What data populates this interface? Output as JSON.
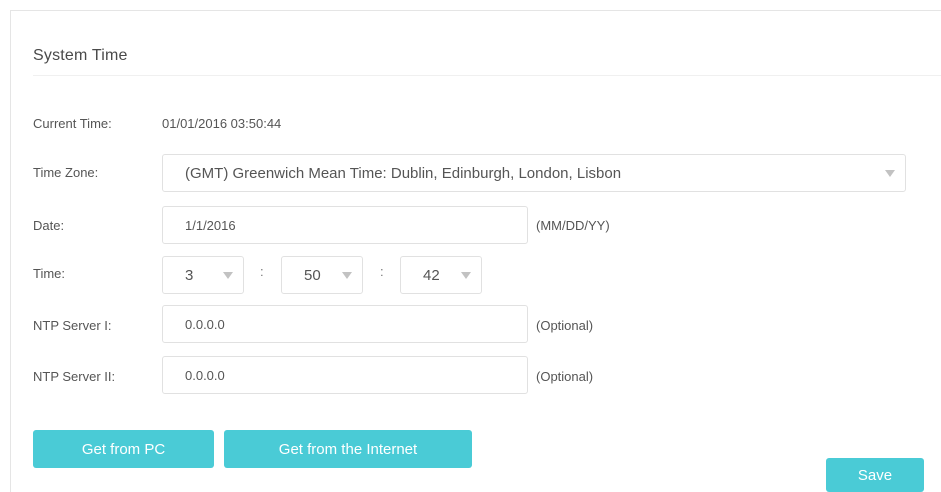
{
  "section": {
    "title": "System Time"
  },
  "current_time": {
    "label": "Current Time:",
    "value": "01/01/2016 03:50:44"
  },
  "time_zone": {
    "label": "Time Zone:",
    "selected": "(GMT) Greenwich Mean Time: Dublin, Edinburgh, London, Lisbon"
  },
  "date": {
    "label": "Date:",
    "value": "1/1/2016",
    "hint": "(MM/DD/YY)"
  },
  "time": {
    "label": "Time:",
    "hour": "3",
    "minute": "50",
    "second": "42",
    "separator": ":"
  },
  "ntp1": {
    "label": "NTP Server I:",
    "value": "0.0.0.0",
    "hint": "(Optional)"
  },
  "ntp2": {
    "label": "NTP Server II:",
    "value": "0.0.0.0",
    "hint": "(Optional)"
  },
  "buttons": {
    "get_from_pc": "Get from PC",
    "get_from_internet": "Get from the Internet",
    "save": "Save"
  },
  "colors": {
    "accent": "#4acbd6",
    "text": "#555555",
    "border": "#e1e1e1"
  },
  "icons": {
    "dropdown": "chevron-down-icon"
  }
}
